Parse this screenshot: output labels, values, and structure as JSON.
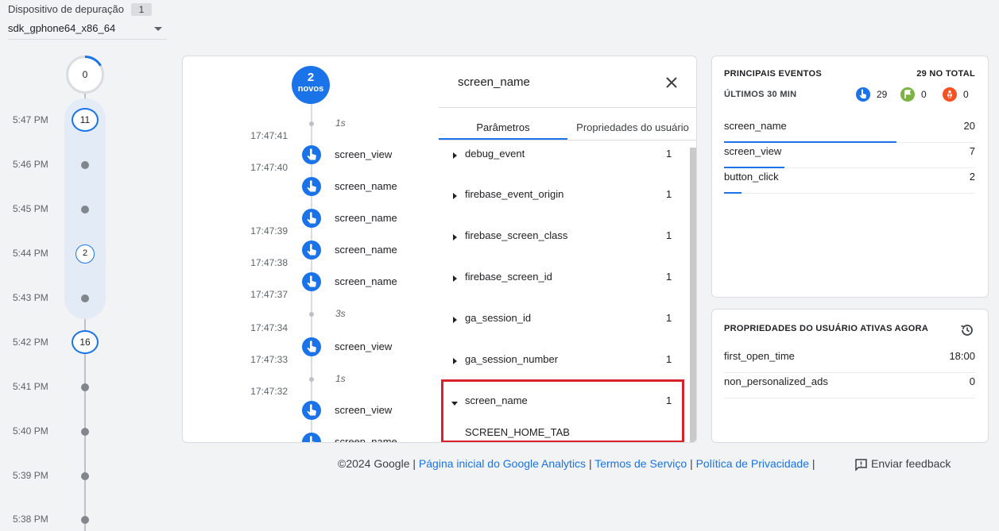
{
  "device": {
    "label": "Dispositivo de depuração",
    "count": "1",
    "selected": "sdk_gphone64_x86_64"
  },
  "minutes": {
    "top_count": "0",
    "rows": [
      {
        "time": "5:47 PM",
        "count": "11"
      },
      {
        "time": "5:46 PM",
        "count": ""
      },
      {
        "time": "5:45 PM",
        "count": ""
      },
      {
        "time": "5:44 PM",
        "count": "2"
      },
      {
        "time": "5:43 PM",
        "count": ""
      },
      {
        "time": "5:42 PM",
        "count": "16"
      },
      {
        "time": "5:41 PM",
        "count": ""
      },
      {
        "time": "5:40 PM",
        "count": ""
      },
      {
        "time": "5:39 PM",
        "count": ""
      },
      {
        "time": "5:38 PM",
        "count": ""
      }
    ]
  },
  "stream": {
    "new_count": "2",
    "new_label": "novos",
    "gaps": [
      "1s",
      "3s",
      "1s"
    ],
    "timestamps": [
      "17:47:41",
      "17:47:40",
      "17:47:39",
      "17:47:38",
      "17:47:37",
      "17:47:34",
      "17:47:33",
      "17:47:32"
    ],
    "events": [
      "screen_view",
      "screen_name",
      "screen_name",
      "screen_name",
      "screen_name",
      "screen_view",
      "screen_view",
      "screen_name"
    ]
  },
  "params": {
    "title": "screen_name",
    "tabs": [
      "Parâmetros",
      "Propriedades do usuário"
    ],
    "rows": [
      {
        "name": "debug_event",
        "count": "1"
      },
      {
        "name": "firebase_event_origin",
        "count": "1"
      },
      {
        "name": "firebase_screen_class",
        "count": "1"
      },
      {
        "name": "firebase_screen_id",
        "count": "1"
      },
      {
        "name": "ga_session_id",
        "count": "1"
      },
      {
        "name": "ga_session_number",
        "count": "1"
      },
      {
        "name": "screen_name",
        "count": "1"
      }
    ],
    "expanded_value": "SCREEN_HOME_TAB"
  },
  "top_events": {
    "title": "PRINCIPAIS EVENTOS",
    "total": "29 NO TOTAL",
    "period": "ÚLTIMOS 30 MIN",
    "kpis": {
      "events": "29",
      "conversions": "0",
      "errors": "0"
    },
    "rows": [
      {
        "name": "screen_name",
        "count": "20",
        "share": 1.0
      },
      {
        "name": "screen_view",
        "count": "7",
        "share": 0.35
      },
      {
        "name": "button_click",
        "count": "2",
        "share": 0.1
      }
    ]
  },
  "user_props": {
    "title": "PROPRIEDADES DO USUÁRIO ATIVAS AGORA",
    "rows": [
      {
        "name": "first_open_time",
        "value": "18:00"
      },
      {
        "name": "non_personalized_ads",
        "value": "0"
      }
    ]
  },
  "footer": {
    "copyright": "©2024 Google",
    "links": [
      "Página inicial do Google Analytics",
      "Termos de Serviço",
      "Política de Privacidade"
    ],
    "feedback": "Enviar feedback"
  },
  "colors": {
    "accent": "#1a73e8",
    "highlight": "#d9232a",
    "conversion": "#7cb342",
    "error": "#f4511e"
  }
}
